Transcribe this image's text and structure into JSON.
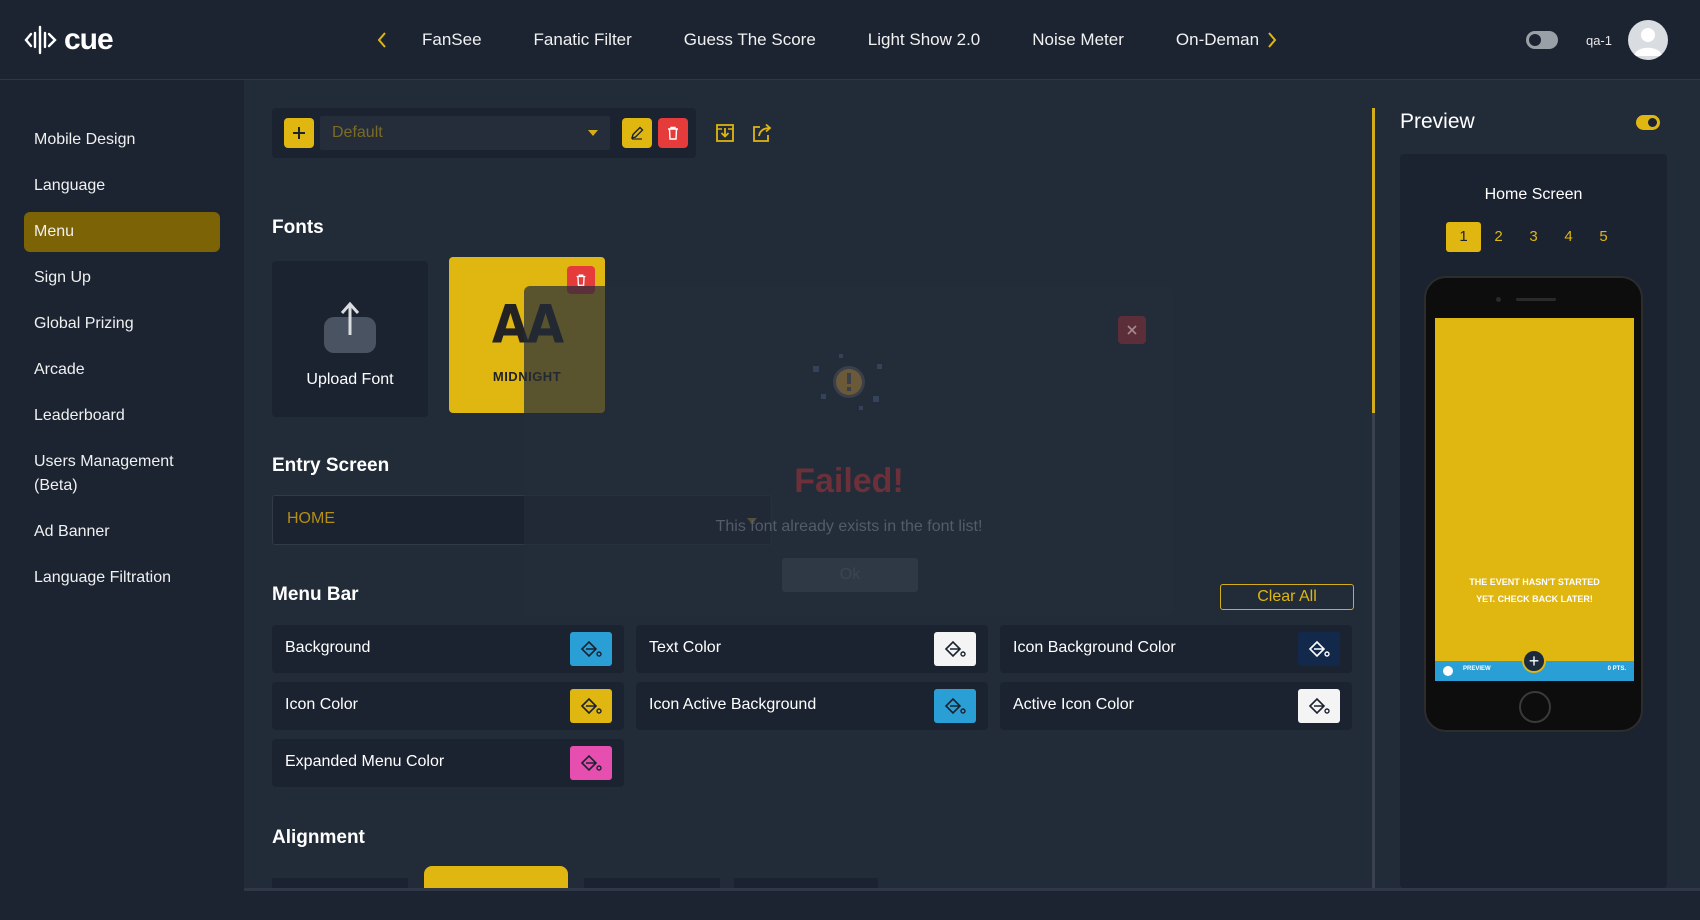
{
  "app": {
    "logo_text": "cue"
  },
  "topnav": {
    "items": [
      "FanSee",
      "Fanatic Filter",
      "Guess The Score",
      "Light Show 2.0",
      "Noise Meter",
      "On-Demand"
    ],
    "username": "qa-1"
  },
  "sidebar": {
    "items": [
      {
        "label": "Mobile Design"
      },
      {
        "label": "Language"
      },
      {
        "label": "Menu",
        "active": true
      },
      {
        "label": "Sign Up"
      },
      {
        "label": "Global Prizing"
      },
      {
        "label": "Arcade"
      },
      {
        "label": "Leaderboard"
      },
      {
        "label": "Users Management (Beta)"
      },
      {
        "label": "Ad Banner"
      },
      {
        "label": "Language Filtration"
      }
    ]
  },
  "toolbar": {
    "preset_value": "Default"
  },
  "fonts": {
    "title": "Fonts",
    "upload_label": "Upload Font",
    "font_preview": "AA",
    "font_name": "MIDNIGHT"
  },
  "entry_screen": {
    "title": "Entry Screen",
    "value": "HOME"
  },
  "menu_bar": {
    "title": "Menu Bar",
    "clear_all": "Clear All",
    "colors": [
      {
        "label": "Background",
        "color": "#2a9fd6"
      },
      {
        "label": "Text Color",
        "color": "#f4f4f4"
      },
      {
        "label": "Icon Background Color",
        "color": "#13294b"
      },
      {
        "label": "Icon Color",
        "color": "#e0b611"
      },
      {
        "label": "Icon Active Background",
        "color": "#2a9fd6"
      },
      {
        "label": "Active Icon Color",
        "color": "#f4f4f4"
      },
      {
        "label": "Expanded Menu Color",
        "color": "#e64fb0"
      }
    ]
  },
  "alignment": {
    "title": "Alignment"
  },
  "modal": {
    "title": "Failed!",
    "message": "This font already exists in the font list!",
    "ok_label": "Ok"
  },
  "preview": {
    "title": "Preview",
    "screen_label": "Home Screen",
    "pages": [
      "1",
      "2",
      "3",
      "4",
      "5"
    ],
    "active_page": "1",
    "event_message": "The Event hasn't started yet. Check back later!",
    "menu_label": "PREVIEW",
    "menu_points": "0 PTS."
  },
  "colors": {
    "accent": "#e0b611",
    "danger": "#e53b3b",
    "bg": "#222b38",
    "panel": "#1b2230"
  }
}
